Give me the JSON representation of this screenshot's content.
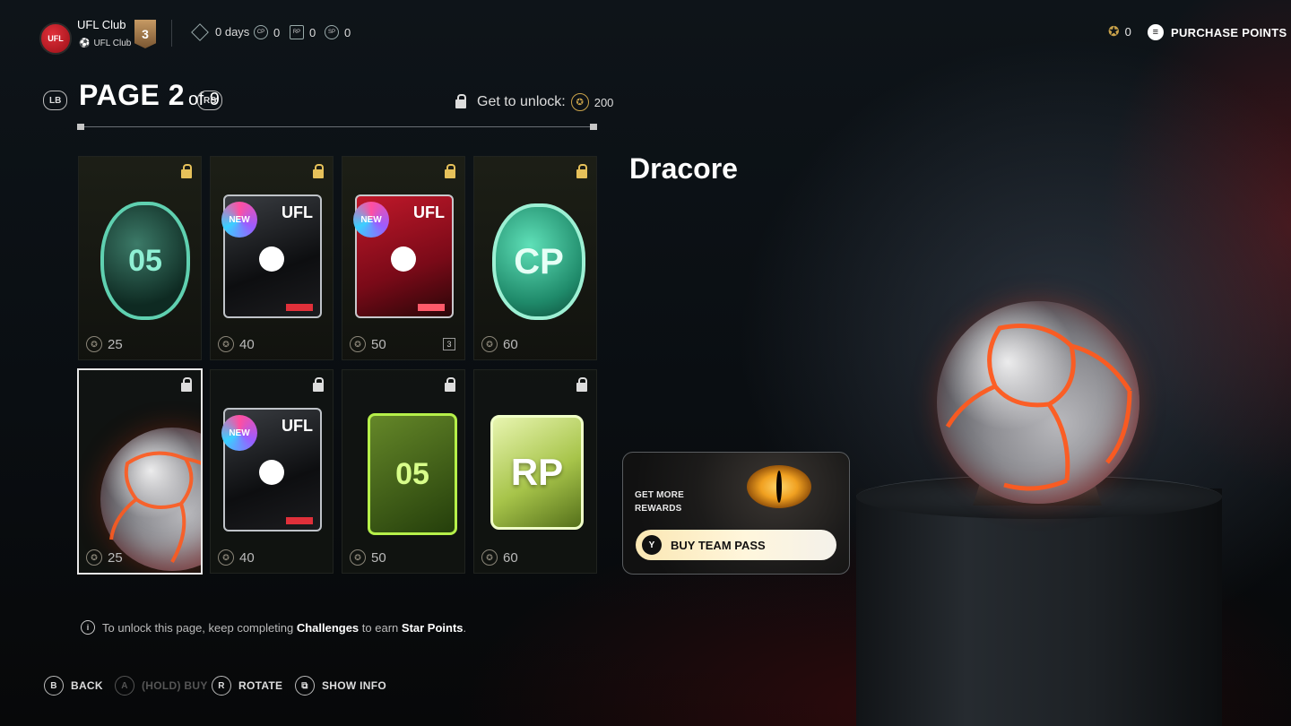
{
  "header": {
    "club_logo_text": "UFL",
    "club_name": "UFL Club",
    "club_sub": "UFL Club",
    "level": "3",
    "days": "0 days",
    "cp": "0",
    "rp": "0",
    "sp_stat": "0",
    "star_points": "0",
    "purchase_label": "PURCHASE POINTS"
  },
  "pager": {
    "lb": "LB",
    "rb": "RB",
    "page_label": "PAGE 2",
    "of_label": "of 9",
    "unlock_label": "Get to unlock:",
    "unlock_cost": "200"
  },
  "tiles": [
    {
      "name": "cp-coin",
      "cost": "25",
      "art_text": "05"
    },
    {
      "name": "ufl-pack-new",
      "cost": "40",
      "art_text": "UFL",
      "badge": "NEW"
    },
    {
      "name": "ufl-pack-red",
      "cost": "50",
      "art_text": "UFL",
      "badge": "NEW",
      "qty": "3"
    },
    {
      "name": "cp-big-coin",
      "cost": "60",
      "art_text": "CP"
    },
    {
      "name": "dracore-ball",
      "cost": "25"
    },
    {
      "name": "ufl-pack-new-2",
      "cost": "40",
      "art_text": "UFL",
      "badge": "NEW"
    },
    {
      "name": "rp-token",
      "cost": "50",
      "art_text": "05"
    },
    {
      "name": "rp-plus",
      "cost": "60",
      "art_text": "RP"
    }
  ],
  "detail": {
    "title": "Dracore",
    "promo_line1": "GET MORE",
    "promo_line2": "REWARDS",
    "promo_button_key": "Y",
    "promo_button_label": "BUY TEAM PASS"
  },
  "footer": {
    "info_prefix": "To unlock this page, keep completing",
    "info_challenges": "Challenges",
    "info_mid": "to earn",
    "info_points": "Star Points",
    "info_suffix": ".",
    "hints": [
      {
        "key": "B",
        "label": "BACK"
      },
      {
        "key": "A",
        "label": "(HOLD) BUY"
      },
      {
        "key": "R",
        "label": "ROTATE"
      },
      {
        "key": "⧉",
        "label": "SHOW INFO"
      }
    ]
  },
  "colors": {
    "accent_gold": "#c9a24a",
    "promo_button": "#fbe7b3",
    "seam": "#ff5a1e"
  }
}
